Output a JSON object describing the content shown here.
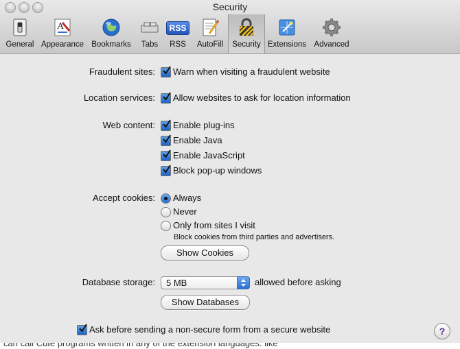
{
  "window": {
    "title": "Security"
  },
  "toolbar": {
    "items": [
      {
        "label": "General",
        "icon": "general-switch-icon"
      },
      {
        "label": "Appearance",
        "icon": "appearance-icon"
      },
      {
        "label": "Bookmarks",
        "icon": "bookmarks-globe-icon"
      },
      {
        "label": "Tabs",
        "icon": "tabs-icon"
      },
      {
        "label": "RSS",
        "icon": "rss-icon"
      },
      {
        "label": "AutoFill",
        "icon": "autofill-icon"
      },
      {
        "label": "Security",
        "icon": "lock-icon",
        "selected": true
      },
      {
        "label": "Extensions",
        "icon": "extensions-icon"
      },
      {
        "label": "Advanced",
        "icon": "gear-icon"
      }
    ],
    "rss_badge": "RSS"
  },
  "fraudulent": {
    "label": "Fraudulent sites:",
    "option": "Warn when visiting a fraudulent website",
    "checked": true
  },
  "location": {
    "label": "Location services:",
    "option": "Allow websites to ask for location information",
    "checked": true
  },
  "web_content": {
    "label": "Web content:",
    "options": [
      {
        "text": "Enable plug-ins",
        "checked": true
      },
      {
        "text": "Enable Java",
        "checked": true
      },
      {
        "text": "Enable JavaScript",
        "checked": true
      },
      {
        "text": "Block pop-up windows",
        "checked": true
      }
    ]
  },
  "cookies": {
    "label": "Accept cookies:",
    "options": [
      {
        "text": "Always",
        "selected": true
      },
      {
        "text": "Never",
        "selected": false
      },
      {
        "text": "Only from sites I visit",
        "selected": false
      }
    ],
    "note": "Block cookies from third parties and advertisers.",
    "button": "Show Cookies"
  },
  "database": {
    "label": "Database storage:",
    "value": "5 MB",
    "suffix": "allowed before asking",
    "button": "Show Databases"
  },
  "nonsecure": {
    "option": "Ask before sending a non-secure form from a secure website",
    "checked": true
  },
  "help": {
    "label": "?"
  },
  "background_text": "can call Cute programs written in any of the extension languages. like"
}
